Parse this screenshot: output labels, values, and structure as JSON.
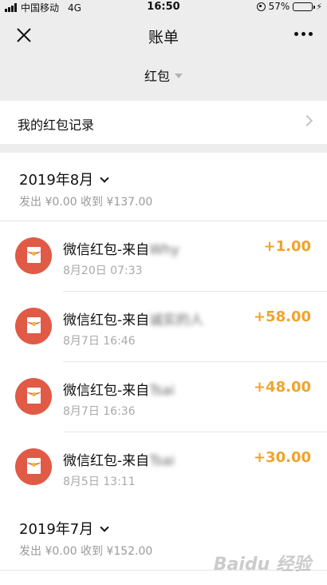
{
  "status_bar": {
    "carrier": "中国移动",
    "network": "4G",
    "time": "16:50",
    "battery_percent": "57%",
    "battery_level": 0.57
  },
  "nav": {
    "title": "账单",
    "close_icon": "close-icon",
    "more_icon": "more-icon"
  },
  "filter": {
    "label": "红包"
  },
  "record_link": {
    "label": "我的红包记录"
  },
  "months": [
    {
      "title": "2019年8月",
      "summary": "发出 ¥0.00 收到 ¥137.00",
      "transactions": [
        {
          "title": "微信红包-来自",
          "sender": "Why",
          "time": "8月20日 07:33",
          "amount": "+1.00"
        },
        {
          "title": "微信红包-来自",
          "sender": "诚实的人",
          "time": "8月7日 16:46",
          "amount": "+58.00"
        },
        {
          "title": "微信红包-来自",
          "sender": "Tsai",
          "time": "8月7日 16:36",
          "amount": "+48.00"
        },
        {
          "title": "微信红包-来自",
          "sender": "Tsai",
          "time": "8月5日 13:11",
          "amount": "+30.00"
        }
      ]
    },
    {
      "title": "2019年7月",
      "summary": "发出 ¥0.00 收到 ¥152.00"
    }
  ],
  "colors": {
    "accent_amount": "#f0a32a",
    "avatar_red": "#e05a46",
    "battery_green": "#4cd964"
  },
  "watermark": "Baidu 经验"
}
